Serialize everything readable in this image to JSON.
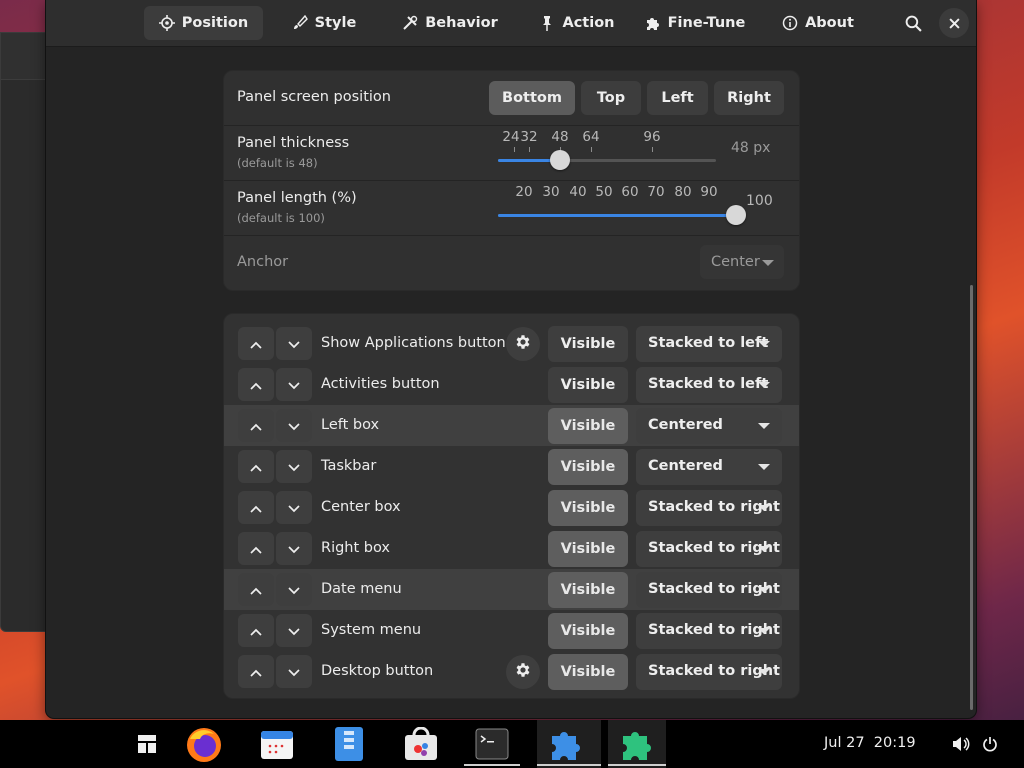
{
  "tabs": [
    {
      "label": "Position",
      "icon": "crosshair-icon",
      "active": true
    },
    {
      "label": "Style",
      "icon": "brush-icon",
      "active": false
    },
    {
      "label": "Behavior",
      "icon": "tools-icon",
      "active": false
    },
    {
      "label": "Action",
      "icon": "pin-icon",
      "active": false
    },
    {
      "label": "Fine-Tune",
      "icon": "puzzle-icon",
      "active": false
    },
    {
      "label": "About",
      "icon": "info-icon",
      "active": false
    }
  ],
  "header_icons": {
    "search": "search-icon",
    "close": "close-icon"
  },
  "position_settings": {
    "screen_position": {
      "label": "Panel screen position",
      "options": [
        "Bottom",
        "Top",
        "Left",
        "Right"
      ],
      "selected": "Bottom"
    },
    "thickness": {
      "label": "Panel thickness",
      "default_text": "(default is 48)",
      "marks": [
        "24",
        "32",
        "48",
        "64",
        "96"
      ],
      "value": 48,
      "value_text": "48 px"
    },
    "length": {
      "label": "Panel length (%)",
      "default_text": "(default is 100)",
      "marks": [
        "20",
        "30",
        "40",
        "50",
        "60",
        "70",
        "80",
        "90"
      ],
      "value": 100,
      "value_text": "100"
    },
    "anchor": {
      "label": "Anchor",
      "value": "Center",
      "enabled": false
    }
  },
  "elements": [
    {
      "name": "Show Applications button",
      "has_settings": true,
      "visibility": "Visible",
      "position": "Stacked to left",
      "highlight": false
    },
    {
      "name": "Activities button",
      "has_settings": false,
      "visibility": "Visible",
      "position": "Stacked to left",
      "highlight": false
    },
    {
      "name": "Left box",
      "has_settings": false,
      "visibility": "Visible",
      "position": "Centered",
      "highlight": true
    },
    {
      "name": "Taskbar",
      "has_settings": false,
      "visibility": "Visible",
      "position": "Centered",
      "highlight": false
    },
    {
      "name": "Center box",
      "has_settings": false,
      "visibility": "Visible",
      "position": "Stacked to right",
      "highlight": false
    },
    {
      "name": "Right box",
      "has_settings": false,
      "visibility": "Visible",
      "position": "Stacked to right",
      "highlight": false
    },
    {
      "name": "Date menu",
      "has_settings": false,
      "visibility": "Visible",
      "position": "Stacked to right",
      "highlight": true
    },
    {
      "name": "System menu",
      "has_settings": false,
      "visibility": "Visible",
      "position": "Stacked to right",
      "highlight": false
    },
    {
      "name": "Desktop button",
      "has_settings": true,
      "visibility": "Visible",
      "position": "Stacked to right",
      "highlight": false
    }
  ],
  "taskbar": {
    "apps": [
      "app-grid-icon",
      "firefox-icon",
      "calendar-icon",
      "files-icon",
      "software-store-icon",
      "terminal-icon",
      "extensions-icon",
      "dash-to-panel-settings-icon"
    ],
    "date": "Jul 27",
    "time": "20:19"
  },
  "colors": {
    "accent": "#3a85e4",
    "window_bg": "#242424",
    "card_bg": "#303030"
  }
}
